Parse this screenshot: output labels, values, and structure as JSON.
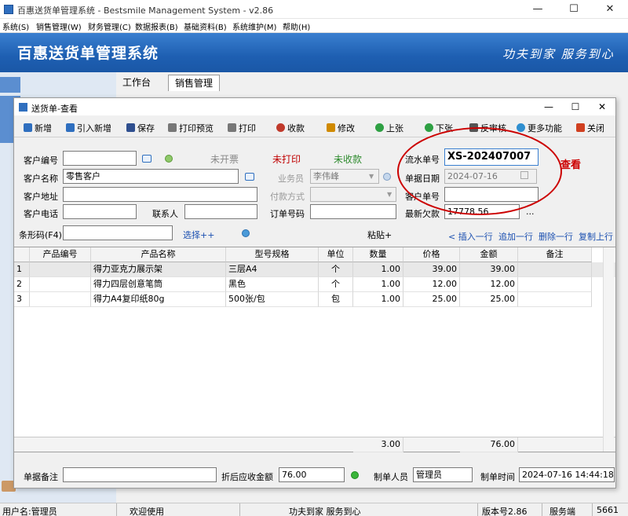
{
  "window": {
    "title": "百惠送货单管理系统 - Bestsmile Management System - v2.86"
  },
  "menu": [
    "系统(S)",
    "销售管理(W)",
    "财务管理(C)",
    "数据报表(B)",
    "基础资料(B)",
    "系统维护(M)",
    "帮助(H)"
  ],
  "banner": {
    "title": "百惠送货单管理系统",
    "slogan": "功夫到家 服务到心"
  },
  "tabs": [
    "工作台",
    "销售管理"
  ],
  "doc": {
    "title": "送货单-查看"
  },
  "toolbar": [
    {
      "label": "新增",
      "icon": "plus-icon",
      "color": "#2f6fbf"
    },
    {
      "label": "引入新增",
      "icon": "import-icon",
      "color": "#2f6fbf"
    },
    {
      "label": "保存",
      "icon": "save-icon",
      "color": "#2f4f8f"
    },
    {
      "label": "打印预览",
      "icon": "print-preview-icon",
      "color": "#777777"
    },
    {
      "label": "打印",
      "icon": "print-icon",
      "color": "#777777"
    },
    {
      "label": "收款",
      "icon": "coins-icon",
      "color": "#c0392b"
    },
    {
      "label": "修改",
      "icon": "edit-icon",
      "color": "#d08a00"
    },
    {
      "label": "上张",
      "icon": "prev-icon",
      "color": "#2ea043"
    },
    {
      "label": "下张",
      "icon": "next-icon",
      "color": "#2ea043"
    },
    {
      "label": "反审核",
      "icon": "unapprove-icon",
      "color": "#555555"
    },
    {
      "label": "更多功能",
      "icon": "more-icon",
      "color": "#2f8fd0"
    },
    {
      "label": "关闭",
      "icon": "close-icon",
      "color": "#d04020"
    }
  ],
  "form": {
    "customer_code_label": "客户编号",
    "customer_code": "",
    "customer_name_label": "客户名称",
    "customer_name": "零售客户",
    "customer_addr_label": "客户地址",
    "customer_addr": "",
    "customer_phone_label": "客户电话",
    "customer_phone": "",
    "contact_label": "联系人",
    "contact": "",
    "invoice_status": "未开票",
    "print_status": "未打印",
    "payment_status": "未收款",
    "salesman_label": "业务员",
    "salesman": "李伟峰",
    "payment_method_label": "付款方式",
    "payment_method": "",
    "order_no_label": "订单号码",
    "order_no": "",
    "serial_label": "流水单号",
    "serial": "XS-202407007",
    "date_label": "单据日期",
    "date": "2024-07-16",
    "cust_doc_label": "客户单号",
    "cust_doc": "",
    "arrears_label": "最新欠款",
    "arrears": "17778.56",
    "ellipsis": "...",
    "barcode_label": "条形码(F4)",
    "barcode": "",
    "select_link": "选择++",
    "paste_link": "粘贴+",
    "row_actions": [
      "< 插入一行",
      "追加一行",
      "删除一行",
      "复制上行"
    ]
  },
  "annotation": {
    "text": "查看",
    "color": "#cc0000"
  },
  "grid": {
    "headers": [
      "",
      "产品编号",
      "产品名称",
      "型号规格",
      "单位",
      "数量",
      "价格",
      "金额",
      "备注"
    ],
    "rows": [
      [
        "1",
        "",
        "得力亚克力展示架",
        "三层A4",
        "个",
        "1.00",
        "39.00",
        "39.00",
        ""
      ],
      [
        "2",
        "",
        "得力四层创意笔筒",
        "黑色",
        "个",
        "1.00",
        "12.00",
        "12.00",
        ""
      ],
      [
        "3",
        "",
        "得力A4复印纸80g",
        "500张/包",
        "包",
        "1.00",
        "25.00",
        "25.00",
        ""
      ]
    ],
    "total_qty": "3.00",
    "total_amount": "76.00"
  },
  "footer": {
    "remark_label": "单据备注",
    "remark": "",
    "receivable_label": "折后应收金额",
    "receivable": "76.00",
    "creator_label": "制单人员",
    "creator": "管理员",
    "created_label": "制单时间",
    "created": "2024-07-16 14:44:18"
  },
  "status": {
    "user": "用户名:管理员",
    "welcome": "欢迎使用",
    "slogan": "功夫到家 服务到心",
    "version": "版本号2.86",
    "server": "服务端",
    "extra": "5661"
  }
}
